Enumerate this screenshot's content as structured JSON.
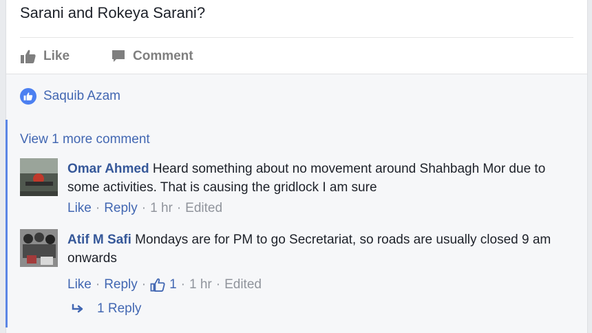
{
  "post": {
    "text": "Sarani and Rokeya Sarani?"
  },
  "actions": {
    "like_label": "Like",
    "comment_label": "Comment"
  },
  "likers": {
    "names": "Saquib Azam"
  },
  "comments": {
    "view_more": "View 1 more comment",
    "items": [
      {
        "author": "Omar Ahmed",
        "text": "Heard something about no movement around Shahbagh Mor due to some activities. That is causing the gridlock I am sure",
        "like_label": "Like",
        "reply_label": "Reply",
        "time": "1 hr",
        "edited": "Edited"
      },
      {
        "author": "Atif M Safi",
        "text": "Mondays are for PM to go Secretariat, so roads are usually closed 9 am onwards",
        "like_label": "Like",
        "reply_label": "Reply",
        "reaction_count": "1",
        "time": "1 hr",
        "edited": "Edited"
      }
    ],
    "replies_label": "1 Reply"
  },
  "colors": {
    "link": "#4267b2",
    "author": "#365899",
    "meta_gray": "#90949c",
    "thread_line": "#5b86e5"
  }
}
